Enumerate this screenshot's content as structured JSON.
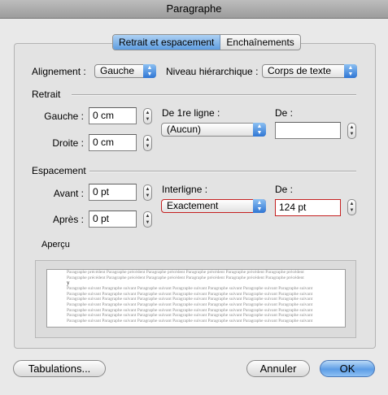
{
  "window": {
    "title": "Paragraphe"
  },
  "tabs": [
    {
      "label": "Retrait et espacement",
      "active": true
    },
    {
      "label": "Enchaînements",
      "active": false
    }
  ],
  "alignement": {
    "label": "Alignement :",
    "value": "Gauche"
  },
  "niveau": {
    "label": "Niveau hiérarchique :",
    "value": "Corps de texte"
  },
  "retrait": {
    "section": "Retrait",
    "gauche_label": "Gauche :",
    "gauche_value": "0 cm",
    "droite_label": "Droite :",
    "droite_value": "0 cm",
    "premiere_label": "De 1re ligne :",
    "premiere_value": "(Aucun)",
    "de_label": "De :",
    "de_value": ""
  },
  "espacement": {
    "section": "Espacement",
    "avant_label": "Avant :",
    "avant_value": "0 pt",
    "apres_label": "Après :",
    "apres_value": "0 pt",
    "interligne_label": "Interligne :",
    "interligne_value": "Exactement",
    "de_label": "De :",
    "de_value": "124 pt"
  },
  "apercu": {
    "label": "Aperçu",
    "prev_line": "Paragraphe précédent Paragraphe précédent Paragraphe précédent Paragraphe précédent Paragraphe précédent Paragraphe précédent",
    "current": "y",
    "next_line": "Paragraphe suivant Paragraphe suivant Paragraphe suivant Paragraphe suivant Paragraphe suivant Paragraphe suivant Paragraphe suivant"
  },
  "buttons": {
    "tabulations": "Tabulations...",
    "annuler": "Annuler",
    "ok": "OK"
  }
}
